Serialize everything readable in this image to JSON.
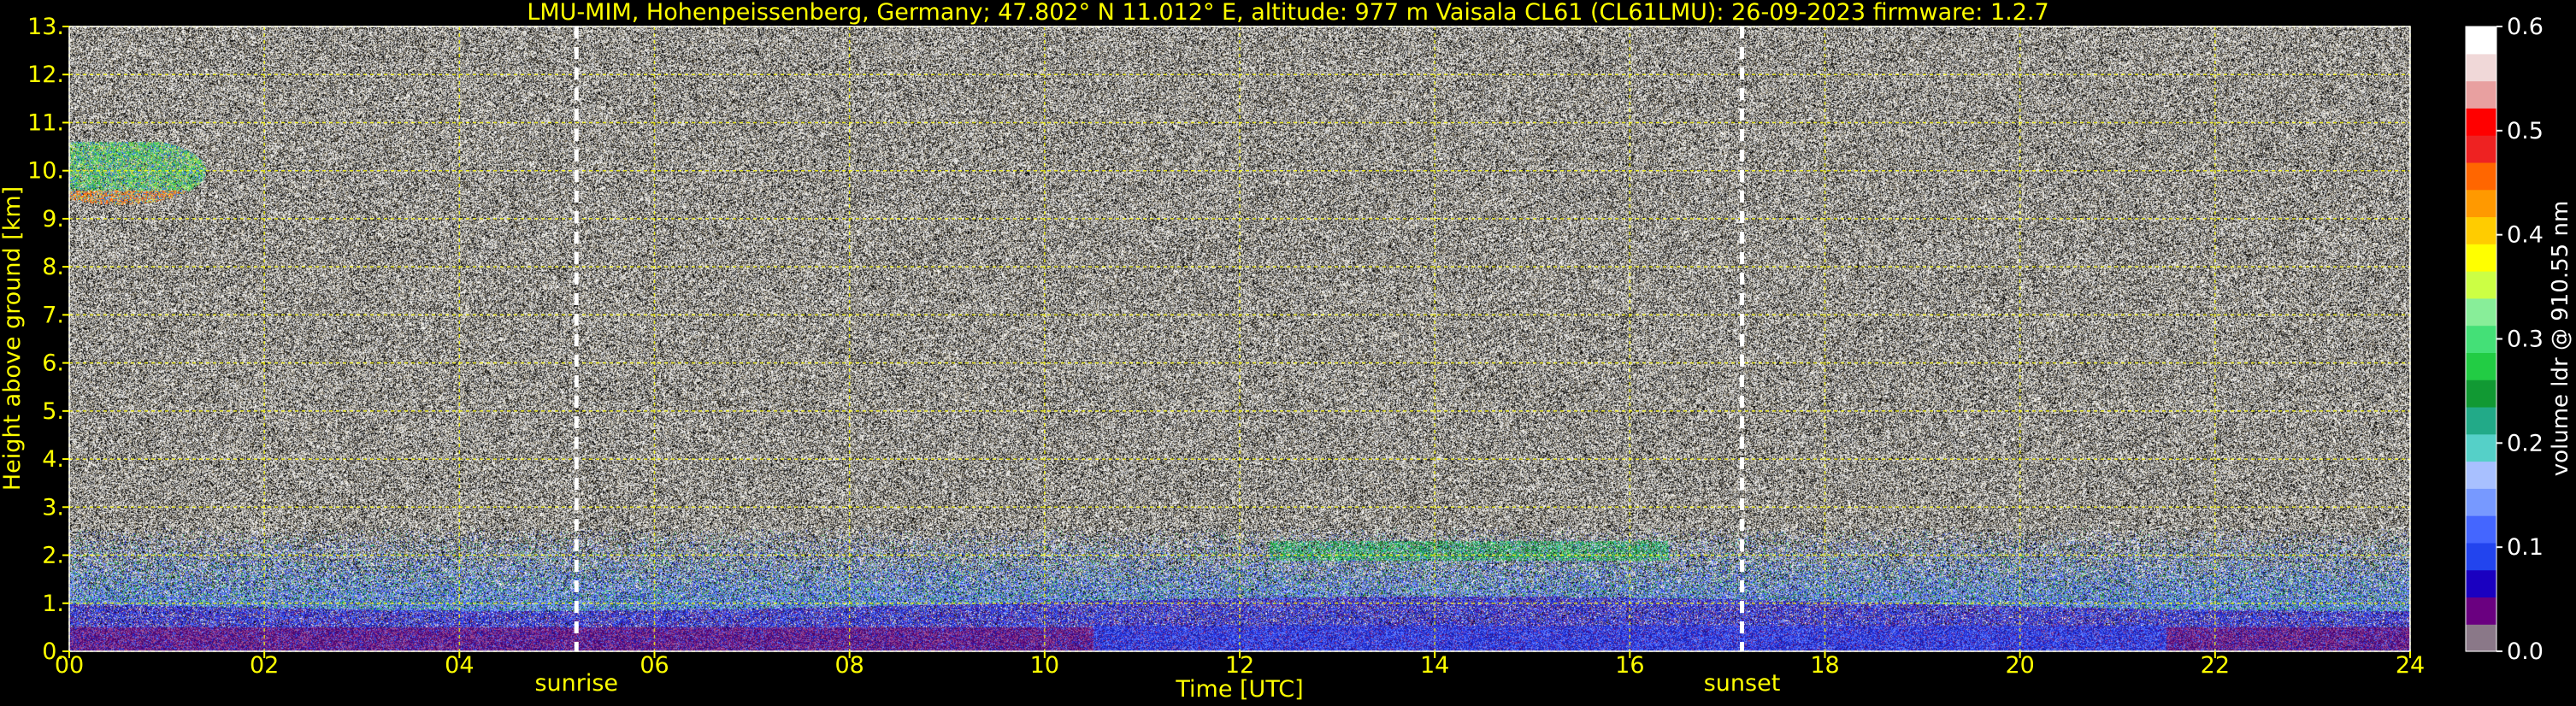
{
  "title": "LMU-MIM, Hohenpeissenberg, Germany; 47.802° N 11.012° E, altitude: 977 m    Vaisala CL61 (CL61LMU): 26-09-2023    firmware: 1.2.7",
  "chart_data": {
    "type": "heatmap",
    "title": "LMU-MIM, Hohenpeissenberg, Germany; 47.802° N 11.012° E, altitude: 977 m    Vaisala CL61 (CL61LMU): 26-09-2023    firmware: 1.2.7",
    "xlabel": "Time [UTC]",
    "ylabel": "Height above ground [km]",
    "xlim": [
      0,
      24
    ],
    "ylim": [
      0,
      13
    ],
    "xticks": [
      "00",
      "02",
      "04",
      "06",
      "08",
      "10",
      "12",
      "14",
      "16",
      "18",
      "20",
      "22",
      "24"
    ],
    "yticks": [
      "0.",
      "1.",
      "2.",
      "3.",
      "4.",
      "5.",
      "6.",
      "7.",
      "8.",
      "9.",
      "10.",
      "11.",
      "12.",
      "13."
    ],
    "grid": true,
    "colorbar": {
      "label": "volume ldr @ 910.55 nm",
      "range": [
        0.0,
        0.6
      ],
      "ticks": [
        "0.0",
        "0.1",
        "0.2",
        "0.3",
        "0.4",
        "0.5",
        "0.6"
      ],
      "colors": [
        "#8a7888",
        "#6a0080",
        "#1a00c0",
        "#2244ee",
        "#4466ff",
        "#7799ff",
        "#a8c0ff",
        "#55d0c8",
        "#22aa88",
        "#119933",
        "#22cc44",
        "#44e077",
        "#88ee99",
        "#ccff44",
        "#ffff00",
        "#ffcc00",
        "#ff9900",
        "#ff6600",
        "#ee2222",
        "#ff0000",
        "#e8a0a0",
        "#f0d8d8",
        "#ffffff"
      ]
    },
    "events": [
      {
        "label": "sunrise",
        "time": 5.2
      },
      {
        "label": "sunset",
        "time": 17.15
      }
    ],
    "features": [
      {
        "name": "high cloud",
        "time_start": 0.0,
        "time_end": 1.4,
        "height_bottom": 9.1,
        "height_top": 10.6
      },
      {
        "name": "boundary layer",
        "time_start": 0.0,
        "time_end": 24.0,
        "height_bottom": 0.0,
        "height_top": 1.0
      },
      {
        "name": "low cloud band",
        "time_start": 12.3,
        "time_end": 16.4,
        "height_bottom": 1.9,
        "height_top": 2.3
      }
    ]
  }
}
